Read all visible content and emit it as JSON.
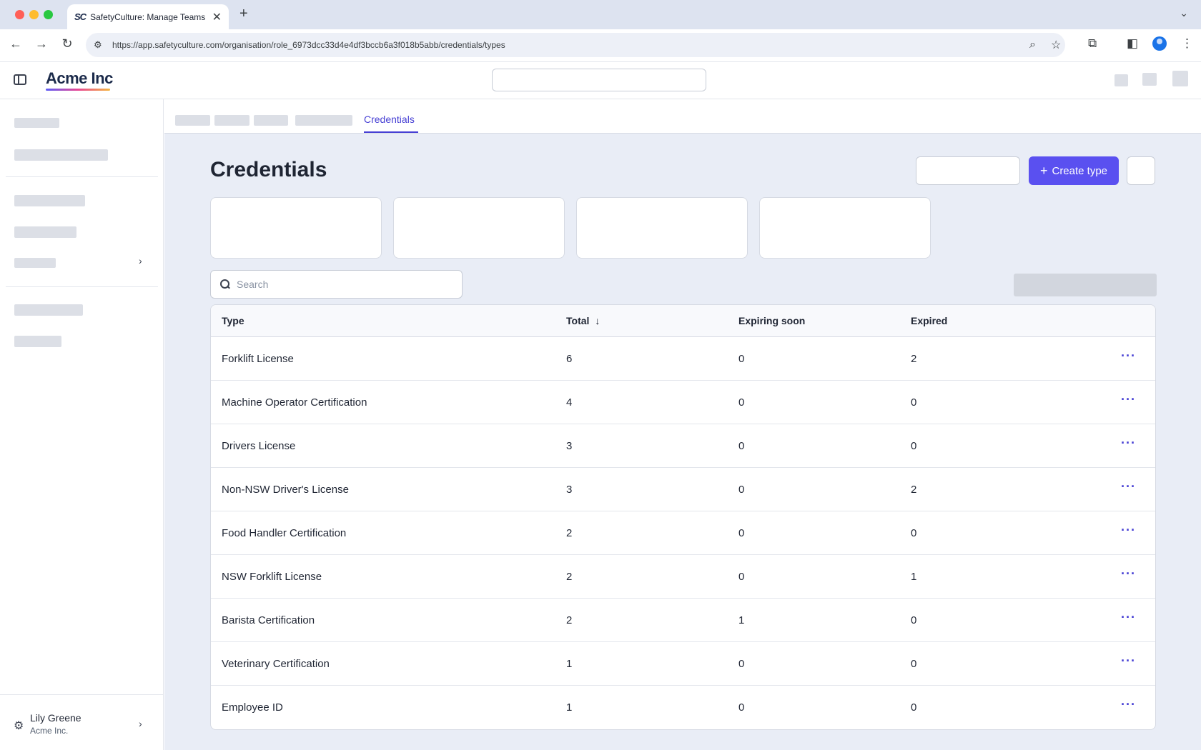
{
  "browser": {
    "tab_favicon": "SC",
    "tab_title": "SafetyCulture: Manage Teams and...",
    "url": "https://app.safetyculture.com/organisation/role_6973dcc33d4e4df3bccb6a3f018b5abb/credentials/types"
  },
  "header": {
    "logo": "Acme Inc"
  },
  "sidebar": {
    "user_name": "Lily Greene",
    "user_org": "Acme Inc."
  },
  "subnav": {
    "active_tab": "Credentials"
  },
  "page": {
    "title": "Credentials",
    "create_button": "Create type",
    "search_placeholder": "Search"
  },
  "table": {
    "columns": {
      "type": "Type",
      "total": "Total",
      "expiring": "Expiring soon",
      "expired": "Expired"
    },
    "rows": [
      {
        "type": "Forklift License",
        "total": "6",
        "expiring": "0",
        "expired": "2"
      },
      {
        "type": "Machine Operator Certification",
        "total": "4",
        "expiring": "0",
        "expired": "0"
      },
      {
        "type": "Drivers License",
        "total": "3",
        "expiring": "0",
        "expired": "0"
      },
      {
        "type": "Non-NSW Driver's License",
        "total": "3",
        "expiring": "0",
        "expired": "2"
      },
      {
        "type": "Food Handler Certification",
        "total": "2",
        "expiring": "0",
        "expired": "0"
      },
      {
        "type": "NSW Forklift License",
        "total": "2",
        "expiring": "0",
        "expired": "1"
      },
      {
        "type": "Barista Certification",
        "total": "2",
        "expiring": "1",
        "expired": "0"
      },
      {
        "type": "Veterinary Certification",
        "total": "1",
        "expiring": "0",
        "expired": "0"
      },
      {
        "type": "Employee ID",
        "total": "1",
        "expiring": "0",
        "expired": "0"
      }
    ]
  },
  "colors": {
    "accent": "#5a50f0",
    "link": "#4740d4",
    "background": "#e9edf6"
  }
}
